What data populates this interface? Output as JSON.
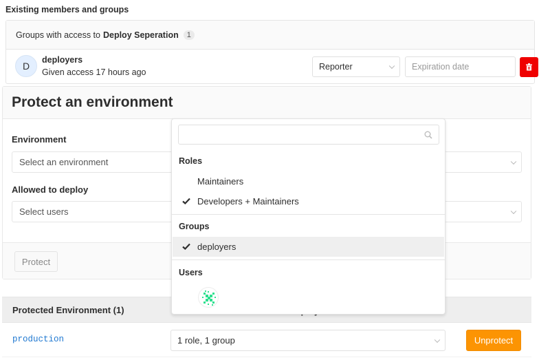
{
  "members": {
    "title": "Existing members and groups",
    "header_prefix": "Groups with access to",
    "project_name": "Deploy Seperation",
    "count": "1",
    "rows": [
      {
        "avatar_letter": "D",
        "name": "deployers",
        "subtitle": "Given access 17 hours ago",
        "role": "Reporter",
        "expiration_placeholder": "Expiration date"
      }
    ]
  },
  "protect": {
    "title": "Protect an environment",
    "environment_label": "Environment",
    "environment_placeholder": "Select an environment",
    "allowed_label": "Allowed to deploy",
    "allowed_placeholder": "Select users",
    "protect_button": "Protect"
  },
  "dropdown": {
    "search_value": "",
    "sections": {
      "roles": {
        "label": "Roles",
        "items": [
          {
            "label": "Maintainers",
            "checked": false
          },
          {
            "label": "Developers + Maintainers",
            "checked": true
          }
        ]
      },
      "groups": {
        "label": "Groups",
        "items": [
          {
            "label": "deployers",
            "checked": true
          }
        ]
      },
      "users": {
        "label": "Users",
        "avatar_accent": "#2ee08f"
      }
    }
  },
  "protected_envs": {
    "header": "Protected Environment (1)",
    "hidden_column_header": "Allowed to deploy",
    "rows": [
      {
        "name": "production",
        "access": "1 role, 1 group",
        "action": "Unprotect"
      }
    ]
  },
  "colors": {
    "danger": "#ef0000",
    "warning": "#fc9403",
    "link": "#1f78d1"
  }
}
